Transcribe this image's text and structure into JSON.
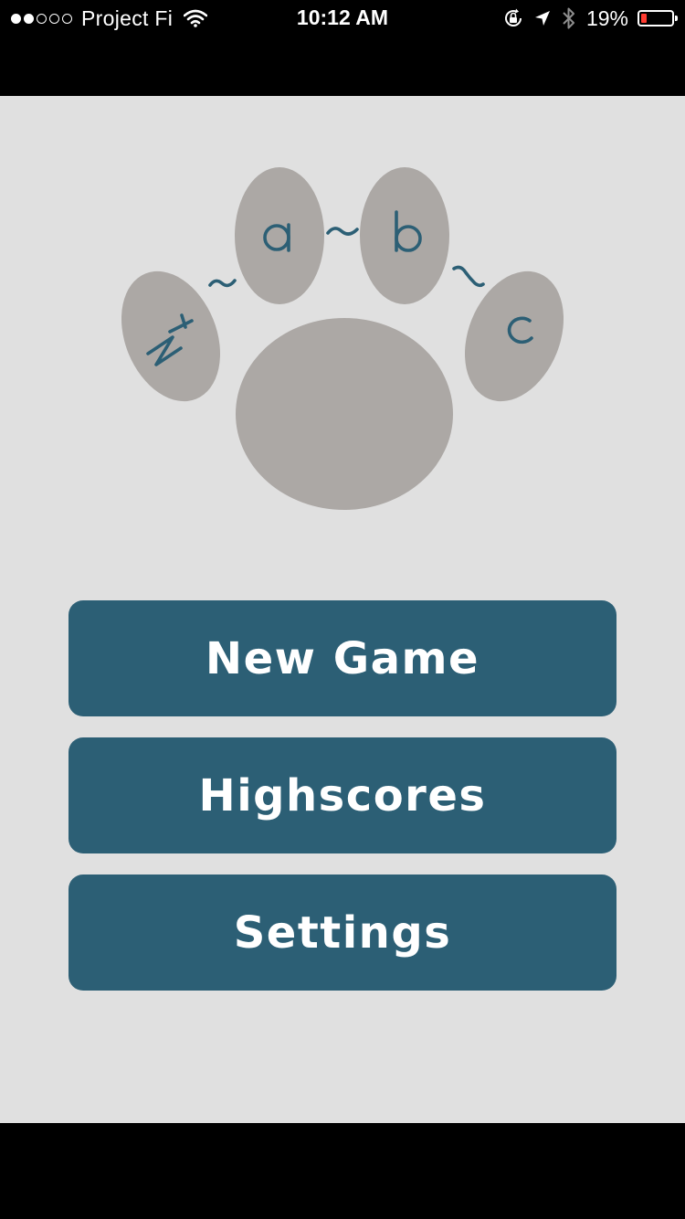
{
  "status_bar": {
    "carrier": "Project Fi",
    "signal_bars_filled": 2,
    "signal_bars_total": 5,
    "time": "10:12 AM",
    "battery_percent": "19%",
    "battery_level": 0.19,
    "icons": [
      "wifi-icon",
      "orientation-lock-icon",
      "location-arrow-icon",
      "bluetooth-icon",
      "battery-icon"
    ]
  },
  "logo": {
    "text": "Ny~a~b~c",
    "paw_color": "#aca8a5",
    "letter_color": "#2c5f75"
  },
  "menu": {
    "new_game": "New Game",
    "highscores": "Highscores",
    "settings": "Settings"
  },
  "colors": {
    "background": "#e0e0e0",
    "button": "#2c5f75",
    "button_text": "#ffffff"
  }
}
